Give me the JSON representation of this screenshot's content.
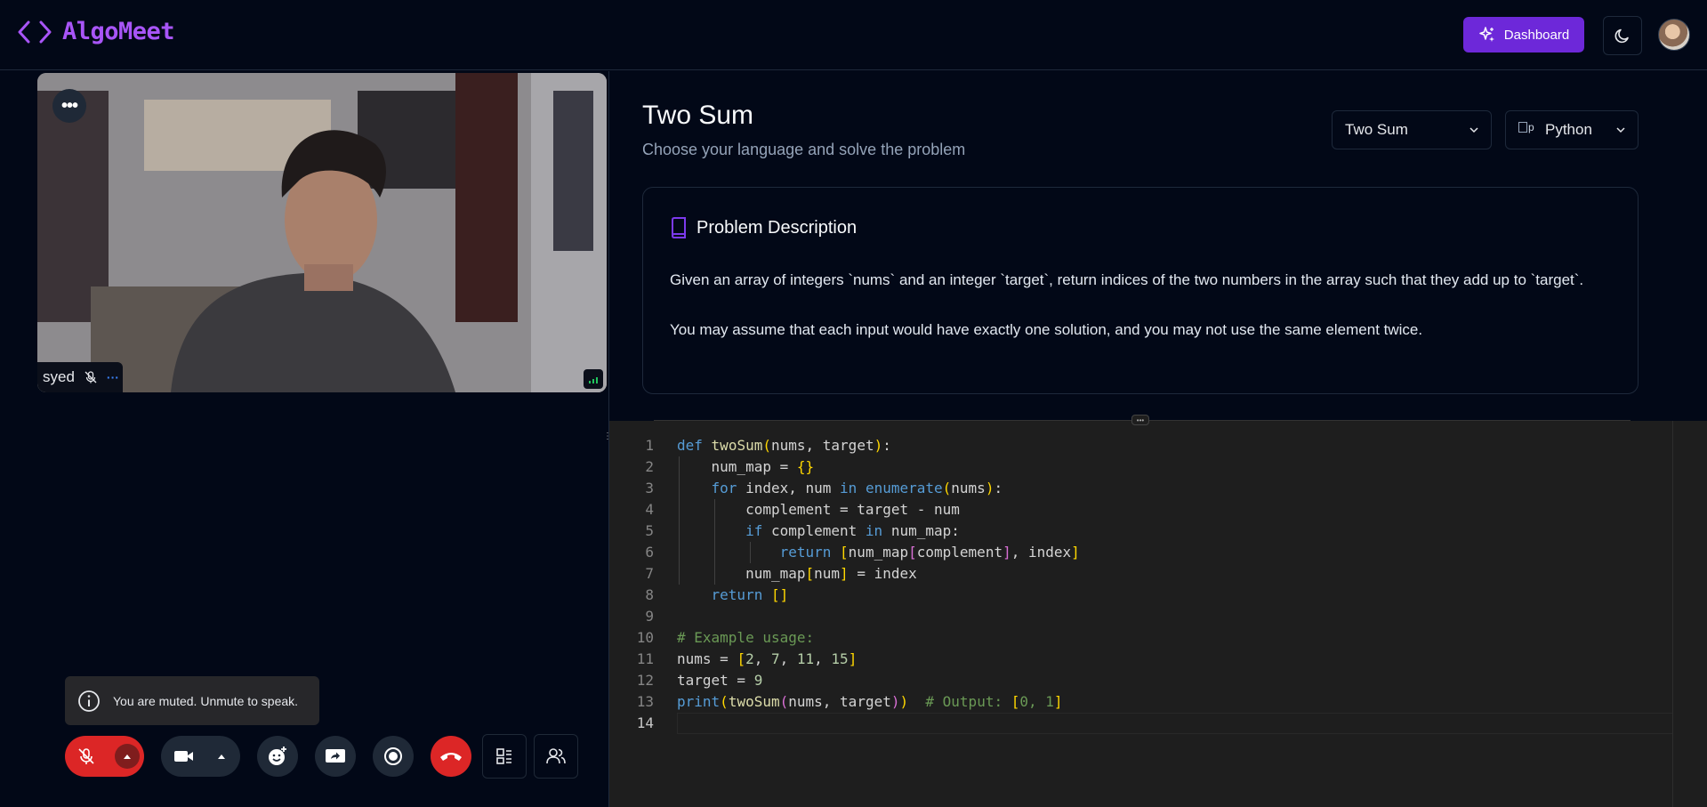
{
  "header": {
    "app_name": "AlgoMeet",
    "dashboard_label": "Dashboard"
  },
  "video": {
    "participant_name": "syed",
    "more_label": "•••",
    "status_dots": "···"
  },
  "toast": {
    "message": "You are muted. Unmute to speak."
  },
  "problem": {
    "title": "Two Sum",
    "subtitle": "Choose your language and solve the problem",
    "problem_select": "Two Sum",
    "language_select": "Python",
    "language_img_alt": "p",
    "description_heading": "Problem Description",
    "description_p1": "Given an array of integers `nums` and an integer `target`, return indices of the two numbers in the array such that they add up to `target`.",
    "description_p2": "You may assume that each input would have exactly one solution, and you may not use the same element twice."
  },
  "editor": {
    "line_numbers": [
      "1",
      "2",
      "3",
      "4",
      "5",
      "6",
      "7",
      "8",
      "9",
      "10",
      "11",
      "12",
      "13",
      "14"
    ]
  },
  "colors": {
    "accent": "#6d28d9",
    "logo": "#a855f7",
    "danger": "#dc2626"
  },
  "icons": {
    "logo": "code-brackets-icon",
    "dashboard": "sparkles-icon",
    "theme": "moon-icon",
    "mic": "mic-off-icon",
    "camera": "video-icon",
    "reaction": "emoji-plus-icon",
    "share": "screen-share-icon",
    "record": "record-icon",
    "leave": "phone-hangup-icon",
    "layout": "layout-list-icon",
    "participants": "users-icon"
  }
}
